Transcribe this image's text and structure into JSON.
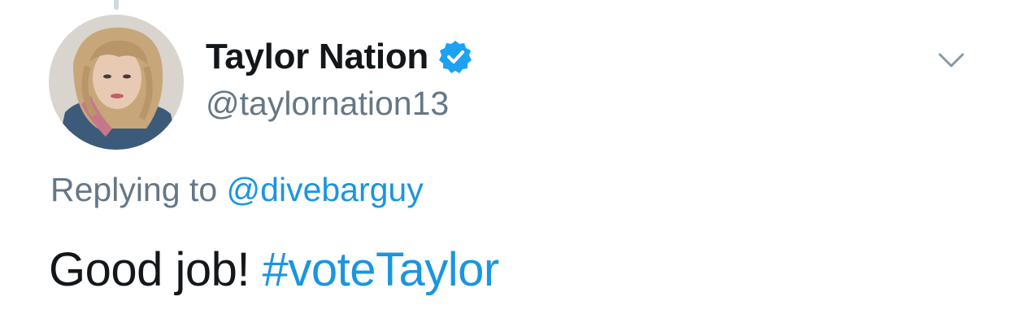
{
  "tweet": {
    "author": {
      "display_name": "Taylor Nation",
      "handle": "@taylornation13",
      "verified": true,
      "avatar": "profile-photo"
    },
    "reply": {
      "prefix": "Replying to",
      "mention": "@divebarguy"
    },
    "body": {
      "text": "Good job!",
      "hashtag": "#voteTaylor"
    },
    "menu_icon": "chevron-down-icon"
  },
  "colors": {
    "link": "#1b95e0",
    "secondary_text": "#657786",
    "primary_text": "#14171a",
    "verified": "#1da1f2"
  }
}
